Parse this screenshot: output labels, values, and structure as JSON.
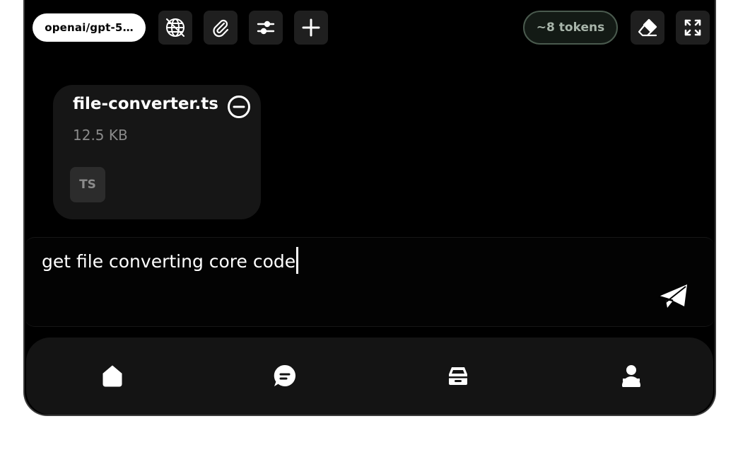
{
  "toolbar": {
    "model_label": "openai/gpt-5…",
    "tokens_label": "~8 tokens",
    "icons": [
      "globe-off-icon",
      "paperclip-icon",
      "sliders-icon",
      "plus-icon",
      "eraser-icon",
      "expand-icon"
    ]
  },
  "attachment": {
    "name": "file-converter.ts",
    "size": "12.5 KB",
    "type_badge": "TS"
  },
  "input": {
    "value": "get file converting core code"
  },
  "bottom_nav": {
    "items": [
      "home-icon",
      "chat-icon",
      "car-icon",
      "profile-icon"
    ]
  },
  "colors": {
    "background": "#000000",
    "accent_tokens_border": "#4a5a4e",
    "tokens_text": "#a8b5aa"
  }
}
